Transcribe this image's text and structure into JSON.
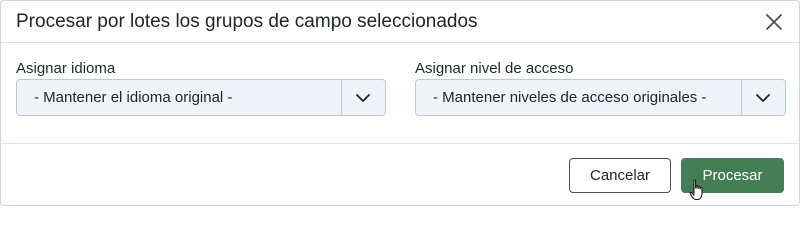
{
  "dialog": {
    "title": "Procesar por lotes los grupos de campo seleccionados",
    "close_icon": "close-icon"
  },
  "fields": {
    "language": {
      "label": "Asignar idioma",
      "value": "- Mantener el idioma original -",
      "icon": "chevron-down-icon"
    },
    "access": {
      "label": "Asignar nivel de acceso",
      "value": "- Mantener niveles de acceso originales -",
      "icon": "chevron-down-icon"
    }
  },
  "buttons": {
    "cancel": "Cancelar",
    "process": "Procesar"
  },
  "colors": {
    "primary": "#457d54",
    "select_bg": "#f0f4fa",
    "select_border": "#b7c9dc",
    "text": "#22262a"
  },
  "cursor": "hand-pointer-icon"
}
